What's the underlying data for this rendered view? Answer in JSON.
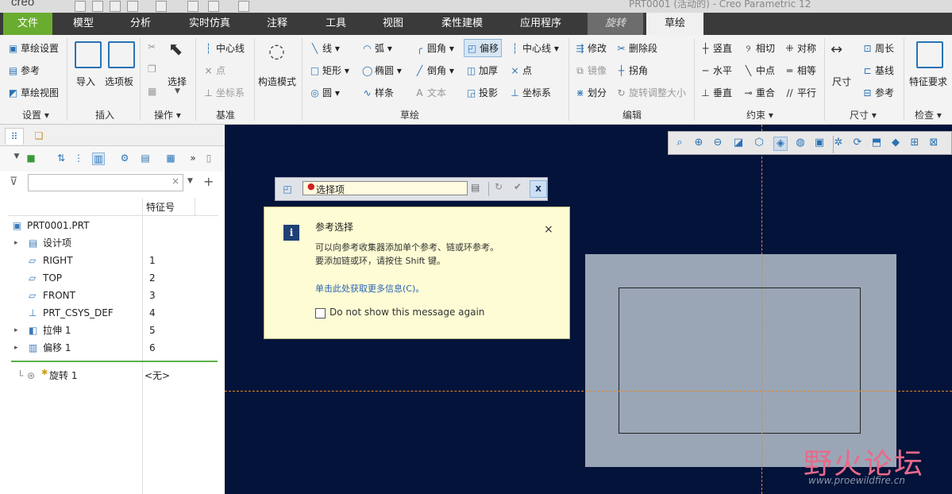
{
  "app": {
    "logo": "creo",
    "title": "PRT0001 (活动的) - Creo Parametric 12"
  },
  "tabs": [
    {
      "label": "文件",
      "kind": "file"
    },
    {
      "label": "模型"
    },
    {
      "label": "分析"
    },
    {
      "label": "实时仿真"
    },
    {
      "label": "注释"
    },
    {
      "label": "工具"
    },
    {
      "label": "视图"
    },
    {
      "label": "柔性建模"
    },
    {
      "label": "应用程序"
    },
    {
      "label": "旋转",
      "kind": "ctx"
    },
    {
      "label": "草绘",
      "kind": "active"
    }
  ],
  "ribbon": {
    "setup": {
      "title": "设置",
      "items": [
        "草绘设置",
        "参考",
        "草绘视图"
      ]
    },
    "insert": {
      "title": "插入",
      "import": "导入",
      "palette": "选项板"
    },
    "ops": {
      "title": "操作",
      "select": "选择"
    },
    "datum": {
      "title": "基准",
      "items": [
        "中心线",
        "点",
        "坐标系"
      ]
    },
    "construction": {
      "label": "构造模式"
    },
    "sketch": {
      "title": "草绘",
      "col1": [
        "线",
        "矩形",
        "圆"
      ],
      "col2": [
        "弧",
        "椭圆",
        "样条"
      ],
      "col3": [
        "圆角",
        "倒角",
        "文本"
      ],
      "col4": [
        "偏移",
        "加厚",
        "投影"
      ],
      "col5": [
        "中心线",
        "点",
        "坐标系"
      ]
    },
    "edit": {
      "title": "编辑",
      "col1": [
        "修改",
        "镜像",
        "划分"
      ],
      "col2": [
        "删除段",
        "拐角",
        "旋转调整大小"
      ]
    },
    "constrain": {
      "title": "约束",
      "col1": [
        "竖直",
        "水平",
        "垂直"
      ],
      "col2": [
        "相切",
        "中点",
        "重合"
      ],
      "col3": [
        "对称",
        "相等",
        "平行"
      ]
    },
    "dimension": {
      "title": "尺寸",
      "big": "尺寸",
      "items": [
        "周长",
        "基线",
        "参考"
      ]
    },
    "inspect": {
      "title": "检查",
      "big": "特征要求"
    }
  },
  "tree": {
    "col_header": "特征号",
    "rows": [
      {
        "label": "PRT0001.PRT",
        "num": "",
        "icon": "part-icon",
        "indent": 0,
        "arrow": false
      },
      {
        "label": "设计项",
        "num": "",
        "icon": "design-items-icon",
        "indent": 1,
        "arrow": true
      },
      {
        "label": "RIGHT",
        "num": "1",
        "icon": "datum-plane-icon",
        "indent": 1,
        "arrow": false
      },
      {
        "label": "TOP",
        "num": "2",
        "icon": "datum-plane-icon",
        "indent": 1,
        "arrow": false
      },
      {
        "label": "FRONT",
        "num": "3",
        "icon": "datum-plane-icon",
        "indent": 1,
        "arrow": false
      },
      {
        "label": "PRT_CSYS_DEF",
        "num": "4",
        "icon": "csys-icon",
        "indent": 1,
        "arrow": false
      },
      {
        "label": "拉伸 1",
        "num": "5",
        "icon": "extrude-icon",
        "indent": 1,
        "arrow": true
      },
      {
        "label": "偏移 1",
        "num": "6",
        "icon": "offset-icon",
        "indent": 1,
        "arrow": true
      }
    ],
    "insert_row": {
      "label": "旋转 1",
      "num": "<无>"
    }
  },
  "dashboard": {
    "collector_label": "选择项"
  },
  "popup": {
    "title": "参考选择",
    "line1": "可以向参考收集器添加单个参考、链或环参考。",
    "line2": "要添加链或环，请按住 Shift 键。",
    "link": "单击此处获取更多信息(C)。",
    "checkbox_label": "Do not show this message again"
  },
  "watermark": {
    "text": "野火论坛",
    "url": "www.proewildfire.cn"
  },
  "colors": {
    "file_tab": "#6aac2f",
    "graphics_bg": "#03133a",
    "sketch_plane": "#9aa6b6",
    "popup_bg": "#fdfcd4",
    "accent": "#2a72b5"
  }
}
